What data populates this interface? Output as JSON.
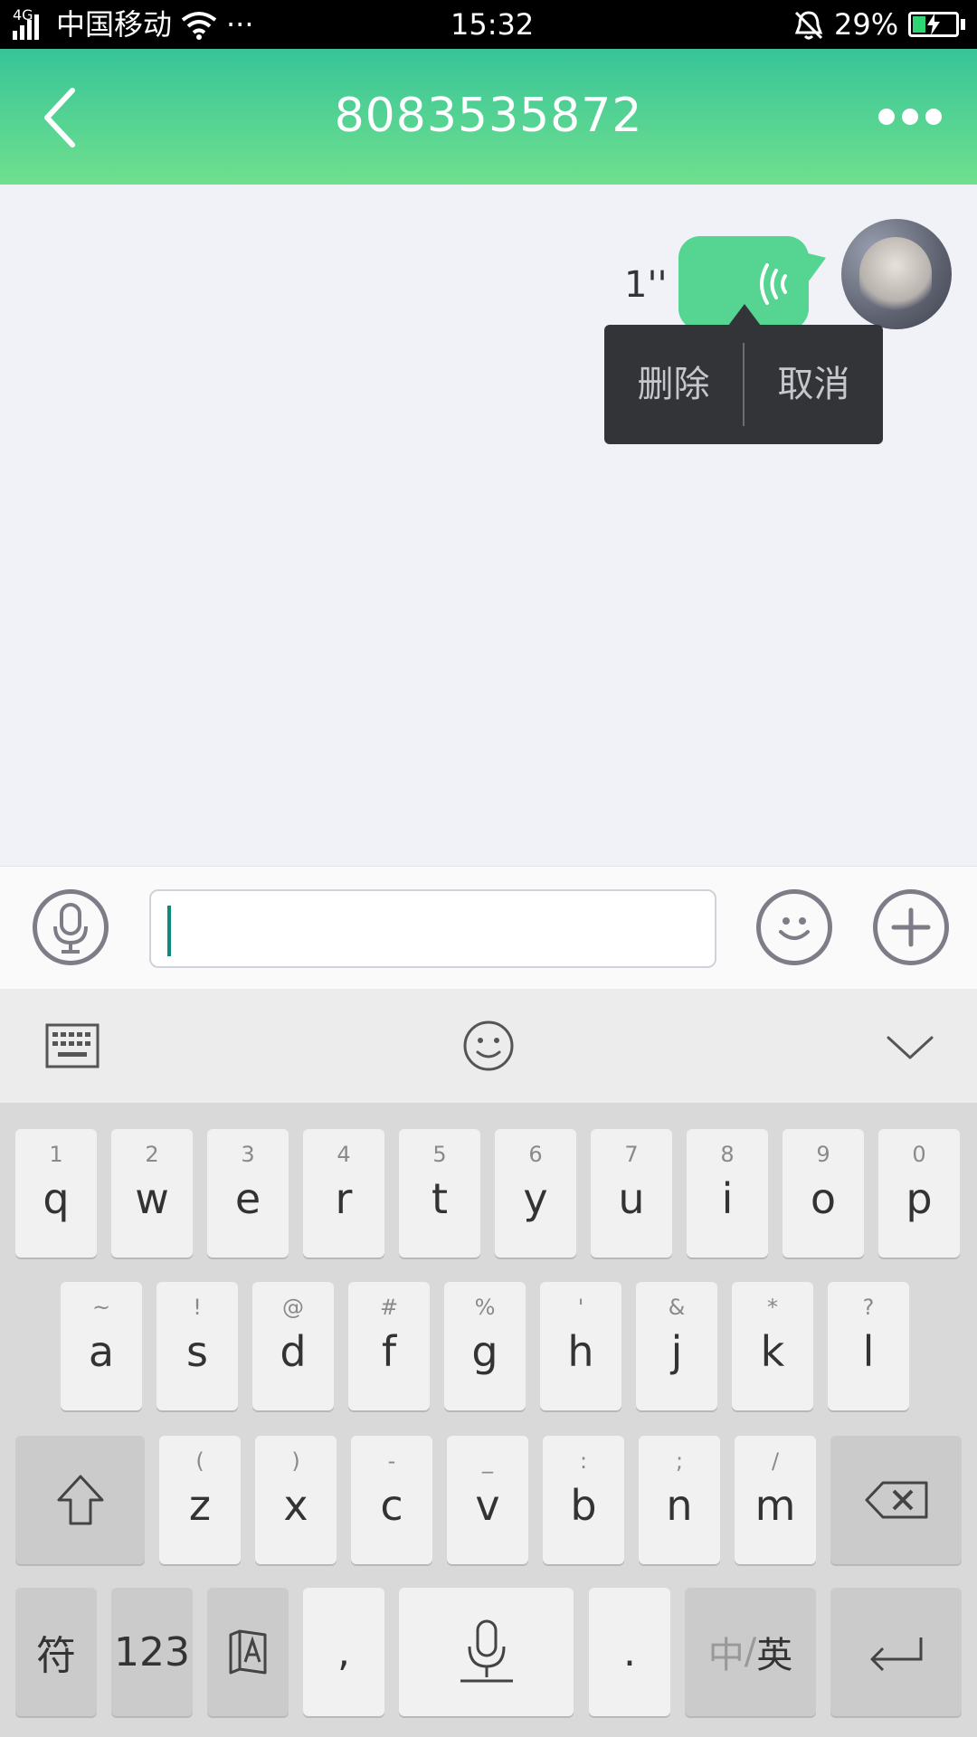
{
  "status_bar": {
    "network_type": "4G",
    "carrier": "中国移动",
    "more": "···",
    "time": "15:32",
    "battery_percent": "29%",
    "battery_level": 0.29
  },
  "header": {
    "title": "8083535872",
    "back_icon": "back-chevron-icon",
    "more_icon": "more-dots-icon"
  },
  "chat": {
    "message_duration": "1''",
    "bubble_color": "#55d492",
    "context_menu": {
      "delete_label": "删除",
      "cancel_label": "取消"
    }
  },
  "input_bar": {
    "voice_icon": "microphone-icon",
    "emoji_icon": "smiley-icon",
    "plus_icon": "plus-icon"
  },
  "keyboard_toolbar": {
    "keyboard_icon": "keyboard-icon",
    "emoji_icon": "smiley-icon",
    "collapse_icon": "chevron-down-icon"
  },
  "keyboard": {
    "row1": [
      {
        "sub": "1",
        "main": "q"
      },
      {
        "sub": "2",
        "main": "w"
      },
      {
        "sub": "3",
        "main": "e"
      },
      {
        "sub": "4",
        "main": "r"
      },
      {
        "sub": "5",
        "main": "t"
      },
      {
        "sub": "6",
        "main": "y"
      },
      {
        "sub": "7",
        "main": "u"
      },
      {
        "sub": "8",
        "main": "i"
      },
      {
        "sub": "9",
        "main": "o"
      },
      {
        "sub": "0",
        "main": "p"
      }
    ],
    "row2": [
      {
        "sub": "~",
        "main": "a"
      },
      {
        "sub": "!",
        "main": "s"
      },
      {
        "sub": "@",
        "main": "d"
      },
      {
        "sub": "#",
        "main": "f"
      },
      {
        "sub": "%",
        "main": "g"
      },
      {
        "sub": "'",
        "main": "h"
      },
      {
        "sub": "&",
        "main": "j"
      },
      {
        "sub": "*",
        "main": "k"
      },
      {
        "sub": "?",
        "main": "l"
      }
    ],
    "row3": [
      {
        "sub": "(",
        "main": "z"
      },
      {
        "sub": ")",
        "main": "x"
      },
      {
        "sub": "-",
        "main": "c"
      },
      {
        "sub": "_",
        "main": "v"
      },
      {
        "sub": ":",
        "main": "b"
      },
      {
        "sub": ";",
        "main": "n"
      },
      {
        "sub": "/",
        "main": "m"
      }
    ],
    "symbols_label": "符",
    "numbers_label": "123",
    "comma_label": ",",
    "period_label": ".",
    "lang_zh": "中",
    "lang_sep": "/",
    "lang_en": "英"
  }
}
